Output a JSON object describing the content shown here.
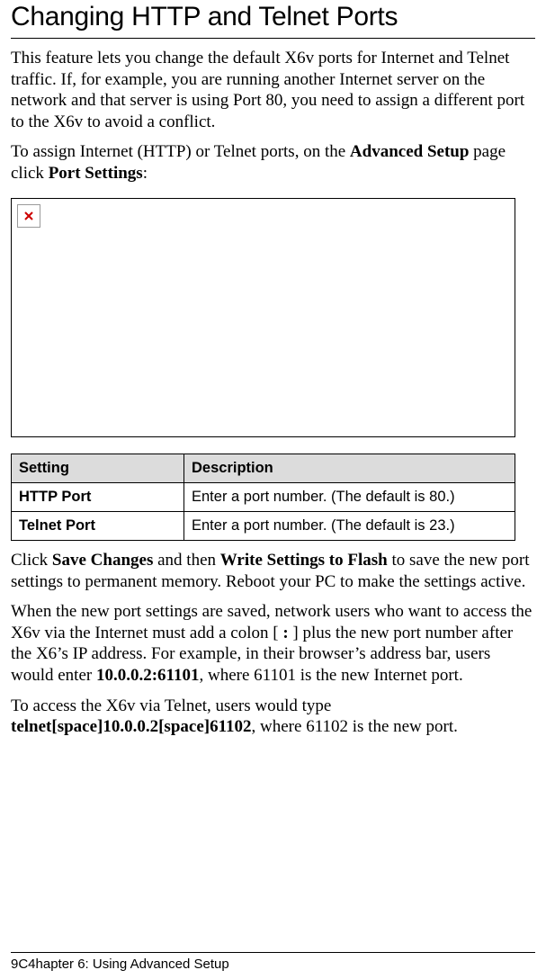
{
  "title": "Changing HTTP and Telnet Ports",
  "para1": "This feature lets you change the default X6v ports for Internet and Telnet traffic. If, for example, you are running another Internet server on the network and that server is using Port 80, you need to assign a different port to the X6v to avoid a conflict.",
  "para2_pre": "To assign Internet (HTTP) or Telnet ports, on the ",
  "para2_bold1": "Advanced Setup",
  "para2_mid1": " page click ",
  "para2_bold2": "Port Settings",
  "para2_post": ":",
  "table": {
    "headers": [
      "Setting",
      "Description"
    ],
    "rows": [
      [
        "HTTP Port",
        "Enter a port number. (The default is 80.)"
      ],
      [
        "Telnet Port",
        "Enter a port number. (The default is 23.)"
      ]
    ]
  },
  "para3_pre": "Click ",
  "para3_b1": "Save Changes",
  "para3_mid1": " and then ",
  "para3_b2": "Write Settings to Flash",
  "para3_post": " to save the new port settings to permanent memory. Reboot your PC to make the settings active.",
  "para4_pre": "When the new port settings are saved, network users who want to access the X6v via the Internet must add a colon [ ",
  "para4_colon": ":",
  "para4_mid1": " ] plus the new port number after the X6’s IP address. For example, in their browser’s address bar, users would enter ",
  "para4_b1": "10.0.0.2:61101",
  "para4_post": ", where 61101 is the new Internet port.",
  "para5_pre": "To access the X6v via Telnet, users would type ",
  "para5_b1": "telnet[space]10.0.0.2[space]61102",
  "para5_post": ", where 61102 is the new port.",
  "footer": {
    "page_overlay": "9C4hapter 6: Using Advanced Setup"
  }
}
